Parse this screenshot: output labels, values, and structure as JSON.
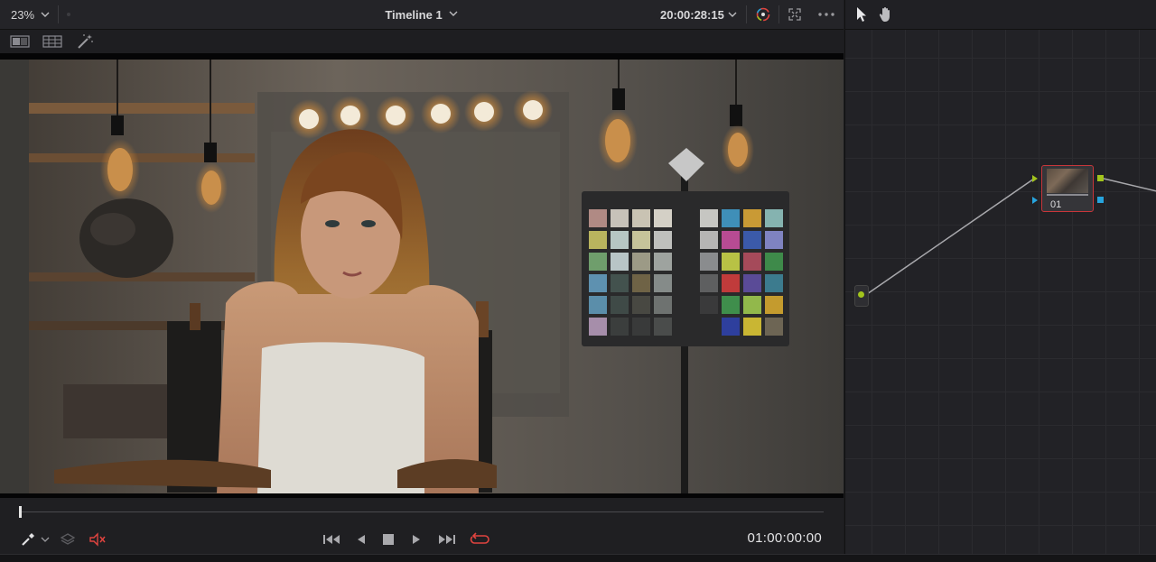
{
  "viewer": {
    "zoom": "23%",
    "title": "Timeline 1",
    "timecode_top": "20:00:28:15",
    "timecode_bottom": "01:00:00:00",
    "toolbar_icons": [
      "single-viewer-icon",
      "split-viewer-icon",
      "magic-wand-icon"
    ],
    "transport_icons": [
      "jump-to-start-icon",
      "step-back-icon",
      "stop-icon",
      "play-icon",
      "jump-to-end-icon",
      "loop-icon"
    ]
  },
  "nodes": {
    "node_label": "01",
    "tools": [
      "pointer-icon",
      "hand-icon"
    ]
  },
  "colors": {
    "accent_red": "#e0443f",
    "node_border": "#c8363a",
    "link_green": "#a2c41c",
    "link_blue": "#27a4dd"
  }
}
